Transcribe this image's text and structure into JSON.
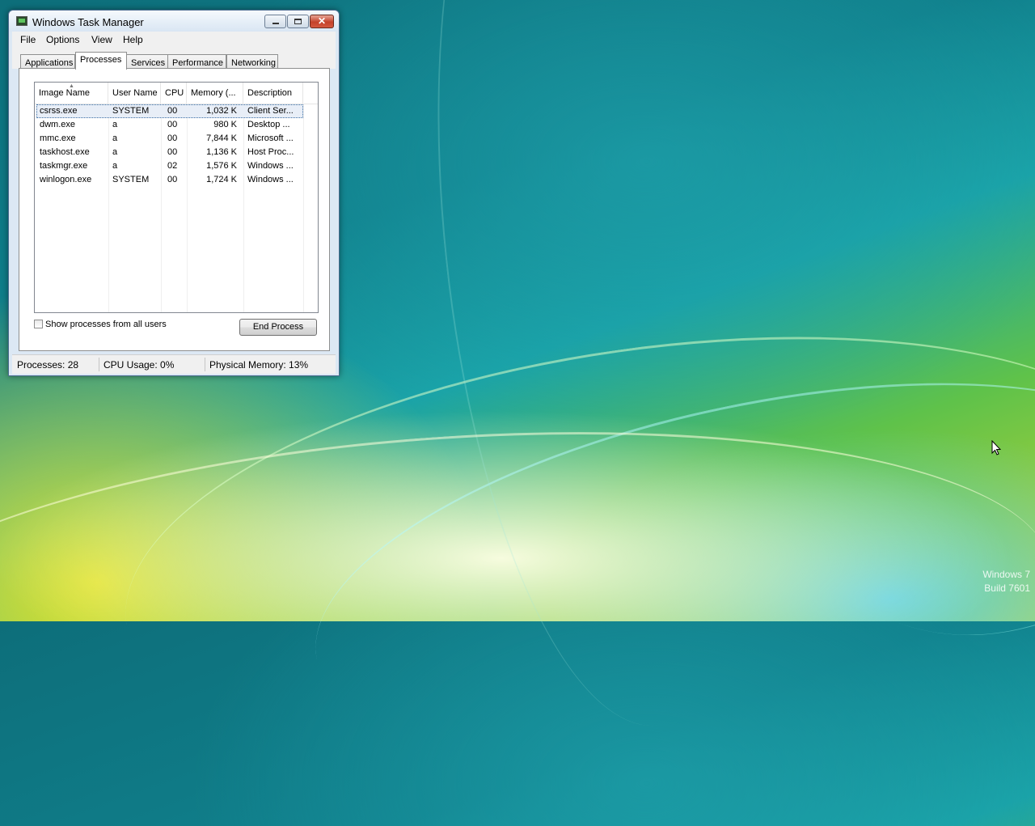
{
  "window": {
    "title": "Windows Task Manager",
    "controls": {
      "minimize": "—",
      "maximize": "□",
      "close": "✕"
    }
  },
  "menu": [
    "File",
    "Options",
    "View",
    "Help"
  ],
  "tabs": [
    {
      "label": "Applications",
      "active": false
    },
    {
      "label": "Processes",
      "active": true
    },
    {
      "label": "Services",
      "active": false
    },
    {
      "label": "Performance",
      "active": false
    },
    {
      "label": "Networking",
      "active": false
    }
  ],
  "process_table": {
    "columns": [
      "Image Name",
      "User Name",
      "CPU",
      "Memory (...",
      "Description"
    ],
    "rows": [
      {
        "image": "csrss.exe",
        "user": "SYSTEM",
        "cpu": "00",
        "memory": "1,032 K",
        "description": "Client Ser...",
        "selected": true
      },
      {
        "image": "dwm.exe",
        "user": "a",
        "cpu": "00",
        "memory": "980 K",
        "description": "Desktop ..."
      },
      {
        "image": "mmc.exe",
        "user": "a",
        "cpu": "00",
        "memory": "7,844 K",
        "description": "Microsoft ..."
      },
      {
        "image": "taskhost.exe",
        "user": "a",
        "cpu": "00",
        "memory": "1,136 K",
        "description": "Host Proc..."
      },
      {
        "image": "taskmgr.exe",
        "user": "a",
        "cpu": "02",
        "memory": "1,576 K",
        "description": "Windows ..."
      },
      {
        "image": "winlogon.exe",
        "user": "SYSTEM",
        "cpu": "00",
        "memory": "1,724 K",
        "description": "Windows ..."
      }
    ]
  },
  "show_all_label": "Show processes from all users",
  "show_all_checked": false,
  "end_process_label": "End Process",
  "status": {
    "processes": "Processes: 28",
    "cpu": "CPU Usage: 0%",
    "memory": "Physical Memory: 13%"
  },
  "desktop": {
    "watermark_line1": "Windows 7",
    "watermark_line2": "Build 7601"
  }
}
